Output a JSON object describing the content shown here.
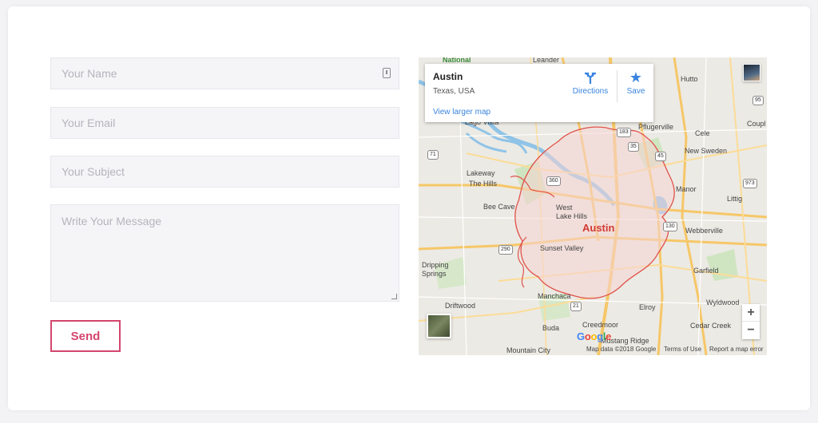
{
  "form": {
    "name_placeholder": "Your Name",
    "email_placeholder": "Your Email",
    "subject_placeholder": "Your Subject",
    "message_placeholder": "Write Your Message",
    "send_label": "Send"
  },
  "map": {
    "infobox": {
      "title": "Austin",
      "subtitle": "Texas, USA",
      "directions_label": "Directions",
      "save_label": "Save",
      "larger_map_link": "View larger map"
    },
    "zoom_in": "+",
    "zoom_out": "−",
    "logo": "Google",
    "attribution": {
      "data": "Map data ©2018 Google",
      "terms": "Terms of Use",
      "report": "Report a map error"
    },
    "places": {
      "national": "National",
      "leander": "Leander",
      "hutto": "Hutto",
      "lago_vista": "Lago Vista",
      "pflugerville": "Pflugerville",
      "coupl": "Coupl",
      "cele": "Cele",
      "new_sweden": "New Sweden",
      "lakeway": "Lakeway",
      "the_hills": "The Hills",
      "manor": "Manor",
      "bee_cave": "Bee Cave",
      "west_lake_hills": "West\nLake Hills",
      "austin": "Austin",
      "littig": "Littig",
      "webberville": "Webberville",
      "sunset_valley": "Sunset Valley",
      "dripping_springs": "Dripping\nSprings",
      "garfield": "Garfield",
      "manchaca": "Manchaca",
      "driftwood": "Driftwood",
      "elroy": "Elroy",
      "wyldwood": "Wyldwood",
      "creedmoor": "Creedmoor",
      "buda": "Buda",
      "cedar_creek": "Cedar Creek",
      "mustang_ridge": "Mustang Ridge",
      "mountain_city": "Mountain City"
    },
    "highways": [
      "183",
      "35",
      "45",
      "95",
      "71",
      "360",
      "290",
      "130",
      "973",
      "21"
    ]
  },
  "colors": {
    "accent": "#d4456e",
    "link": "#3a84df",
    "boundary": "#e0524a",
    "water": "#8fc3e8",
    "road": "#f6c768"
  }
}
